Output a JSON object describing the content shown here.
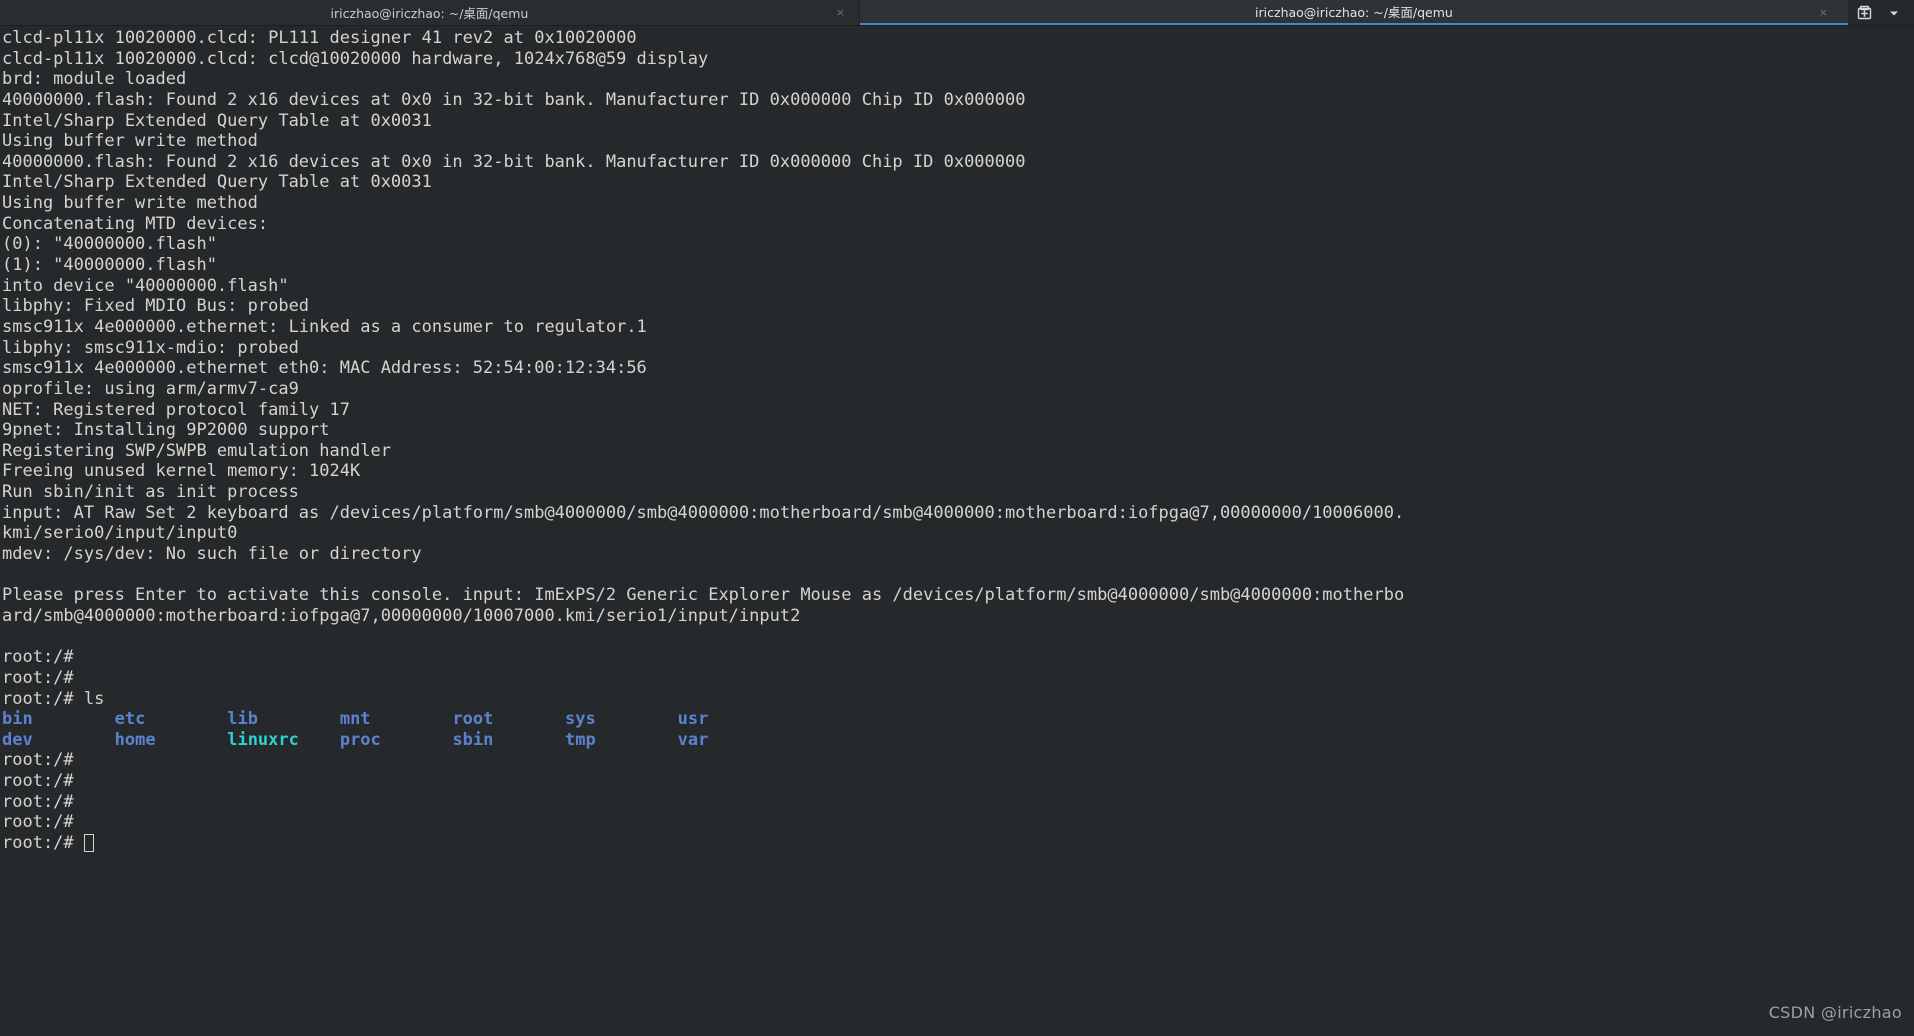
{
  "window": {
    "title": "iriczhao@iriczhao: ~/桌面/qemu"
  },
  "tabbar": {
    "tabs": [
      {
        "label": "iriczhao@iriczhao: ~/桌面/qemu",
        "close_label": "×",
        "active": false
      },
      {
        "label": "iriczhao@iriczhao: ~/桌面/qemu",
        "close_label": "×",
        "active": true
      }
    ],
    "actions": [
      {
        "name": "new-tab-button",
        "tooltip": "New Tab"
      },
      {
        "name": "tab-list-dropdown",
        "tooltip": "Tab list"
      }
    ]
  },
  "terminal": {
    "colors": {
      "background": "#26292b",
      "foreground": "#d6d3cc",
      "directory": "#5c82cf",
      "symlink": "#2fd0d0",
      "accent": "#4a87c5"
    },
    "lines": [
      "clcd-pl11x 10020000.clcd: PL111 designer 41 rev2 at 0x10020000",
      "clcd-pl11x 10020000.clcd: clcd@10020000 hardware, 1024x768@59 display",
      "brd: module loaded",
      "40000000.flash: Found 2 x16 devices at 0x0 in 32-bit bank. Manufacturer ID 0x000000 Chip ID 0x000000",
      "Intel/Sharp Extended Query Table at 0x0031",
      "Using buffer write method",
      "40000000.flash: Found 2 x16 devices at 0x0 in 32-bit bank. Manufacturer ID 0x000000 Chip ID 0x000000",
      "Intel/Sharp Extended Query Table at 0x0031",
      "Using buffer write method",
      "Concatenating MTD devices:",
      "(0): \"40000000.flash\"",
      "(1): \"40000000.flash\"",
      "into device \"40000000.flash\"",
      "libphy: Fixed MDIO Bus: probed",
      "smsc911x 4e000000.ethernet: Linked as a consumer to regulator.1",
      "libphy: smsc911x-mdio: probed",
      "smsc911x 4e000000.ethernet eth0: MAC Address: 52:54:00:12:34:56",
      "oprofile: using arm/armv7-ca9",
      "NET: Registered protocol family 17",
      "9pnet: Installing 9P2000 support",
      "Registering SWP/SWPB emulation handler",
      "Freeing unused kernel memory: 1024K",
      "Run sbin/init as init process",
      "input: AT Raw Set 2 keyboard as /devices/platform/smb@4000000/smb@4000000:motherboard/smb@4000000:motherboard:iofpga@7,00000000/10006000.",
      "kmi/serio0/input/input0",
      "mdev: /sys/dev: No such file or directory",
      "",
      "Please press Enter to activate this console. input: ImExPS/2 Generic Explorer Mouse as /devices/platform/smb@4000000/smb@4000000:motherbo",
      "ard/smb@4000000:motherboard:iofpga@7,00000000/10007000.kmi/serio1/input/input2",
      "",
      "root:/#",
      "root:/#",
      "root:/# ls"
    ],
    "ls_output": {
      "columns": [
        {
          "text": "bin",
          "type": "directory"
        },
        {
          "text": "etc",
          "type": "directory"
        },
        {
          "text": "lib",
          "type": "directory"
        },
        {
          "text": "mnt",
          "type": "directory"
        },
        {
          "text": "root",
          "type": "directory"
        },
        {
          "text": "sys",
          "type": "directory"
        },
        {
          "text": "usr",
          "type": "directory"
        }
      ],
      "columns_row2": [
        {
          "text": "dev",
          "type": "directory"
        },
        {
          "text": "home",
          "type": "directory"
        },
        {
          "text": "linuxrc",
          "type": "symlink"
        },
        {
          "text": "proc",
          "type": "directory"
        },
        {
          "text": "sbin",
          "type": "directory"
        },
        {
          "text": "tmp",
          "type": "directory"
        },
        {
          "text": "var",
          "type": "directory"
        }
      ],
      "row1_raw": "bin        etc        lib        mnt        root       sys        usr",
      "row2_raw": "dev        home       linuxrc    proc       sbin       tmp        var"
    },
    "trailing_prompts": [
      "root:/#",
      "root:/#",
      "root:/#",
      "root:/#"
    ],
    "prompt": "root:/# ",
    "cursor_visible": true
  },
  "watermark": {
    "text": "CSDN @iriczhao"
  }
}
